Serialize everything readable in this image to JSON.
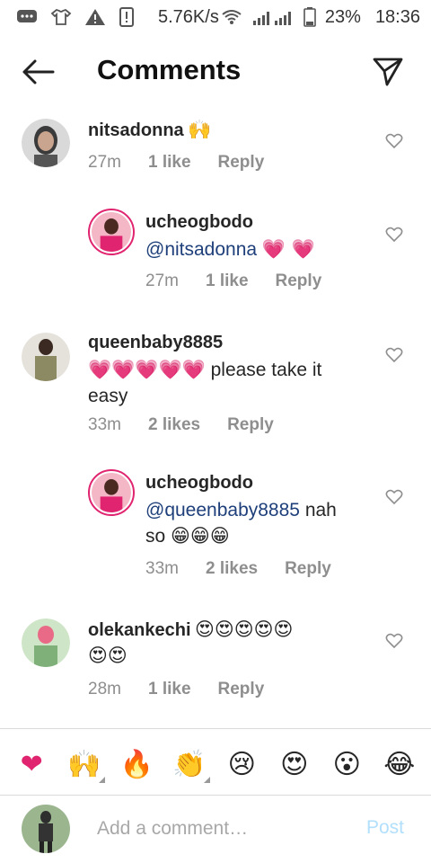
{
  "status_bar": {
    "speed": "5.76K/s",
    "battery": "23%",
    "time": "18:36"
  },
  "header": {
    "title": "Comments"
  },
  "comments": [
    {
      "username": "nitsadonna",
      "text_emoji": "🙌",
      "time": "27m",
      "likes": "1 like",
      "reply": "Reply",
      "avatar_color": "#b8b8b8"
    },
    {
      "username": "ucheogbodo",
      "mention": "@nitsadonna",
      "text_emoji": "💗 💗",
      "time": "27m",
      "likes": "1 like",
      "reply": "Reply",
      "avatar_color": "#e0246f"
    },
    {
      "username": "queenbaby8885",
      "text_emoji": "💗💗💗💗💗",
      "text": "please take it",
      "text2": "easy",
      "time": "33m",
      "likes": "2 likes",
      "reply": "Reply",
      "avatar_color": "#9a9a78"
    },
    {
      "username": "ucheogbodo",
      "mention": "@queenbaby8885",
      "text": "nah",
      "text2": "so",
      "text_emoji": "😁😁😁",
      "time": "33m",
      "likes": "2 likes",
      "reply": "Reply",
      "avatar_color": "#e0246f"
    },
    {
      "username": "olekankechi",
      "text_emoji": "😍😍😍😍😍",
      "text_emoji2": "😍😍",
      "time": "28m",
      "likes": "1 like",
      "reply": "Reply",
      "avatar_color": "#7fb07a"
    }
  ],
  "quick_emojis": [
    "❤",
    "🙌",
    "🔥",
    "👏",
    "😢",
    "😍",
    "😮",
    "😂"
  ],
  "composer": {
    "placeholder": "Add a comment…",
    "post_label": "Post"
  },
  "colors": {
    "accent_mention": "#1e3f7a",
    "post_disabled": "#b2dffc",
    "meta_gray": "#8e8e8e"
  }
}
